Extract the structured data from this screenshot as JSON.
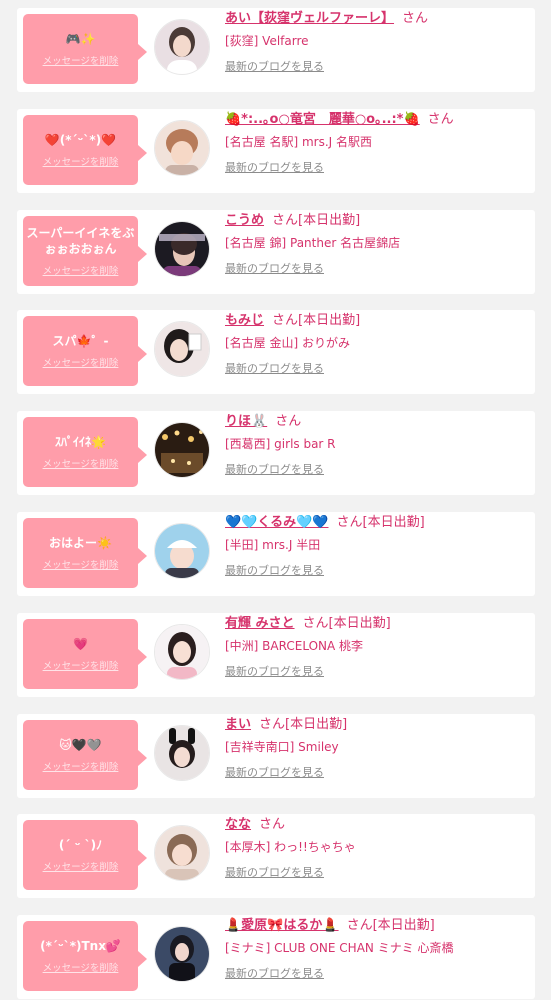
{
  "delete_label": "メッセージを削除",
  "blog_label": "最新のブログを見る",
  "san_label": "さん",
  "colors": {
    "accent": "#d6336c",
    "bubble": "#ff9daa",
    "background": "#f2f2f2",
    "card": "#ffffff"
  },
  "items": [
    {
      "message": "🎮✨",
      "name": "あい【荻窪ヴェルファーレ】",
      "status": "",
      "shop": "[荻窪] Velfarre",
      "avatar_icon": "woman-portrait-icon"
    },
    {
      "message": "❤️(*ˊᵕˋ*)❤️",
      "name": "🍓*:..｡o○竜宮　麗華○o｡..:*🍓",
      "status": "",
      "shop": "[名古屋 名駅] mrs.J 名駅西",
      "avatar_icon": "woman-hair-icon"
    },
    {
      "message": "スーパーイイネをぶぉぉおおぉん",
      "name": "こうめ",
      "status": "[本日出勤]",
      "shop": "[名古屋 錦] Panther 名古屋錦店",
      "avatar_icon": "panther-logo-icon"
    },
    {
      "message": "スパ🍁゜-",
      "name": "もみじ",
      "status": "[本日出勤]",
      "shop": "[名古屋 金山] おりがみ",
      "avatar_icon": "woman-portrait-icon"
    },
    {
      "message": "ｽﾊﾟｲｲﾈ🌟",
      "name": "りほ🐰",
      "status": "",
      "shop": "[西葛西] girls bar R",
      "avatar_icon": "night-lights-icon"
    },
    {
      "message": "おはよー☀️",
      "name": "💙🩵くるみ🩵💙",
      "status": "[本日出勤]",
      "shop": "[半田] mrs.J 半田",
      "avatar_icon": "woman-cap-icon"
    },
    {
      "message": "💗",
      "name": "有輝 みさと",
      "status": "[本日出勤]",
      "shop": "[中洲] BARCELONA 桃李",
      "avatar_icon": "woman-portrait-icon"
    },
    {
      "message": "🐱🖤🩶",
      "name": "まい",
      "status": "[本日出勤]",
      "shop": "[吉祥寺南口] Smiley",
      "avatar_icon": "woman-bunny-icon"
    },
    {
      "message": "(ˊ ᵕ ˋ)ﾉ",
      "name": "なな",
      "status": "",
      "shop": "[本厚木] わっ!!ちゃちゃ",
      "avatar_icon": "woman-portrait-icon"
    },
    {
      "message": "(*ˊᵕˋ*)Tnx💕",
      "name": "💄愛原🎀はるか💄",
      "status": "[本日出勤]",
      "shop": "[ミナミ] CLUB ONE CHAN ミナミ 心斎橋",
      "avatar_icon": "woman-dark-icon"
    }
  ]
}
